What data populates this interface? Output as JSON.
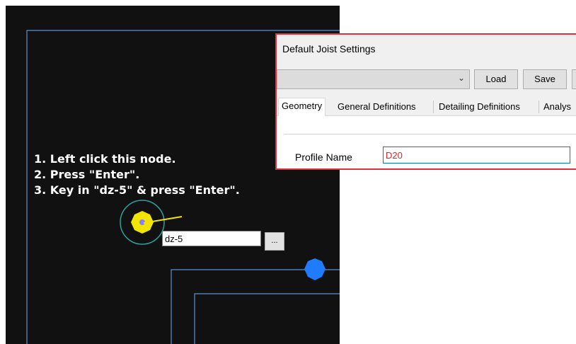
{
  "cad": {
    "instructions": [
      "1. Left click this node.",
      "2. Press \"Enter\".",
      "3. Key in \"dz-5\" & press \"Enter\"."
    ],
    "command_input_value": "dz-5",
    "browse_button_label": "...",
    "colors": {
      "background": "#111111",
      "frame_lines": "#5b8fd6",
      "node_fill": "#f2e600",
      "node_ring": "#2aa39a",
      "node_center": "#8a7cff",
      "blue_node": "#1f7bff"
    }
  },
  "dialog": {
    "title": "Default Joist Settings",
    "combo_value": "",
    "combo_arrow": "chevron-down-icon",
    "buttons": {
      "load": "Load",
      "save": "Save"
    },
    "tabs": [
      "Geometry",
      "General Definitions",
      "Detailing Definitions",
      "Analys"
    ],
    "active_tab": "Geometry",
    "profile_name_label": "Profile Name",
    "profile_name_value": "D20",
    "border_color": "#e0303c"
  }
}
